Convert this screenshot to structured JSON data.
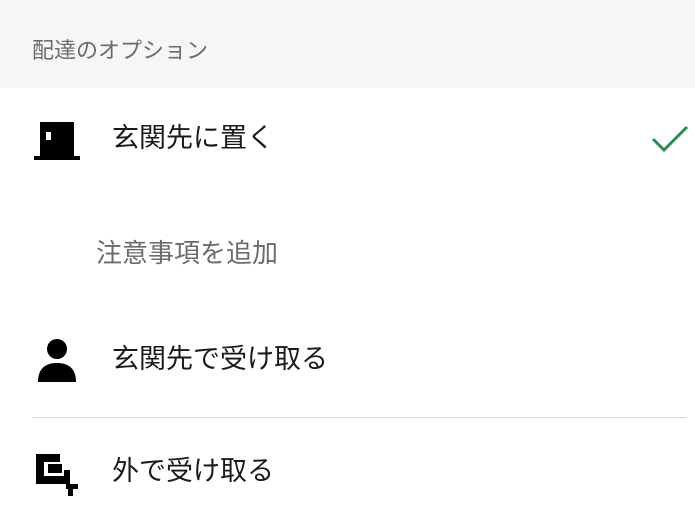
{
  "section": {
    "title": "配達のオプション"
  },
  "options": [
    {
      "label": "玄関先に置く",
      "icon": "door-icon",
      "selected": true
    },
    {
      "label": "玄関先で受け取る",
      "icon": "person-icon",
      "selected": false
    },
    {
      "label": "外で受け取る",
      "icon": "curbside-icon",
      "selected": false
    }
  ],
  "add_note": {
    "label": "注意事項を追加"
  },
  "colors": {
    "check": "#2e8b57",
    "header_bg": "#f6f6f6",
    "muted_text": "#6b6b6b"
  }
}
